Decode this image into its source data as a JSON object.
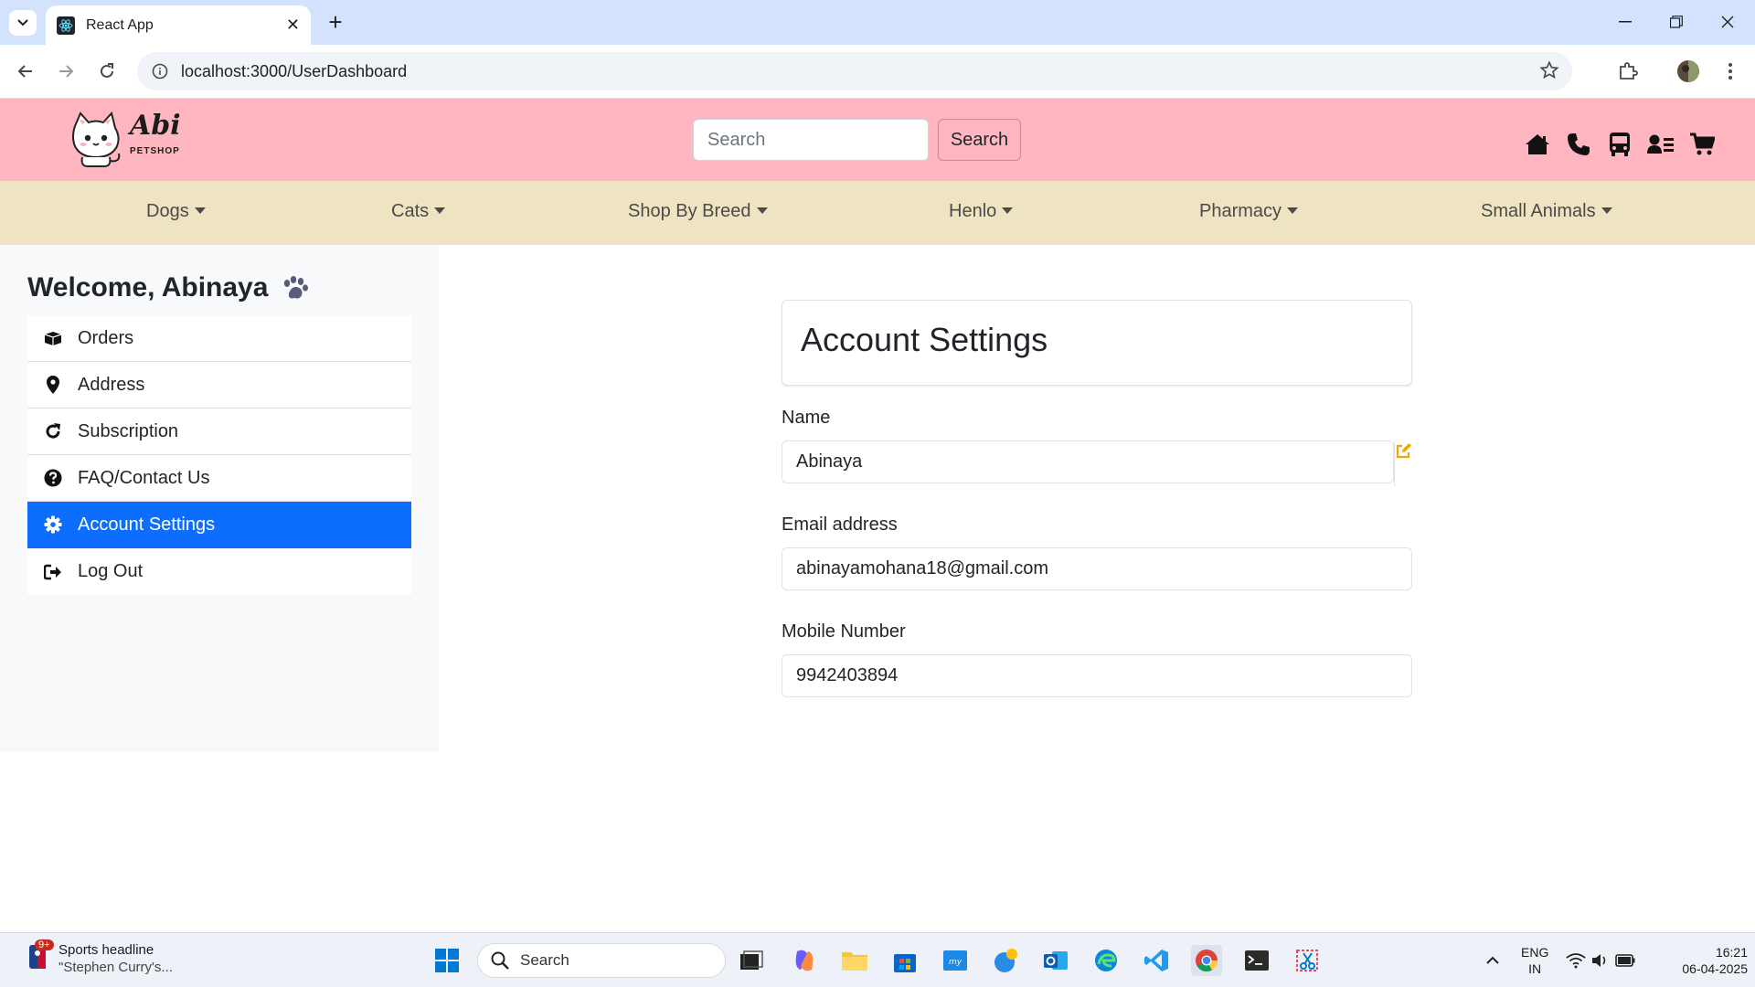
{
  "browser": {
    "tab_title": "React App",
    "url": "localhost:3000/UserDashboard"
  },
  "header": {
    "logo_text": "Abi",
    "logo_sub": "PETSHOP",
    "search_placeholder": "Search",
    "search_button": "Search",
    "icons": [
      "home-icon",
      "phone-icon",
      "bus-icon",
      "user-list-icon",
      "cart-icon"
    ]
  },
  "nav": {
    "items": [
      {
        "label": "Dogs"
      },
      {
        "label": "Cats"
      },
      {
        "label": "Shop By Breed"
      },
      {
        "label": "Henlo"
      },
      {
        "label": "Pharmacy"
      },
      {
        "label": "Small Animals"
      }
    ]
  },
  "sidebar": {
    "welcome": "Welcome, Abinaya",
    "items": [
      {
        "label": "Orders",
        "icon": "box-icon"
      },
      {
        "label": "Address",
        "icon": "location-pin-icon"
      },
      {
        "label": "Subscription",
        "icon": "refresh-icon"
      },
      {
        "label": "FAQ/Contact Us",
        "icon": "question-icon"
      },
      {
        "label": "Account Settings",
        "icon": "gear-icon",
        "active": true
      },
      {
        "label": "Log Out",
        "icon": "logout-icon"
      }
    ]
  },
  "account": {
    "title": "Account Settings",
    "name_label": "Name",
    "name_value": "Abinaya",
    "email_label": "Email address",
    "email_value": "abinayamohana18@gmail.com",
    "mobile_label": "Mobile Number",
    "mobile_value": "9942403894"
  },
  "taskbar": {
    "news_badge": "9+",
    "news_title": "Sports headline",
    "news_sub": "\"Stephen Curry's...",
    "search": "Search",
    "lang_top": "ENG",
    "lang_bottom": "IN",
    "time": "16:21",
    "date": "06-04-2025"
  },
  "colors": {
    "header_bg": "#ffb6c1",
    "nav_bg": "#efe4c1",
    "active": "#0d6efd",
    "edit_icon": "#f0a500"
  }
}
